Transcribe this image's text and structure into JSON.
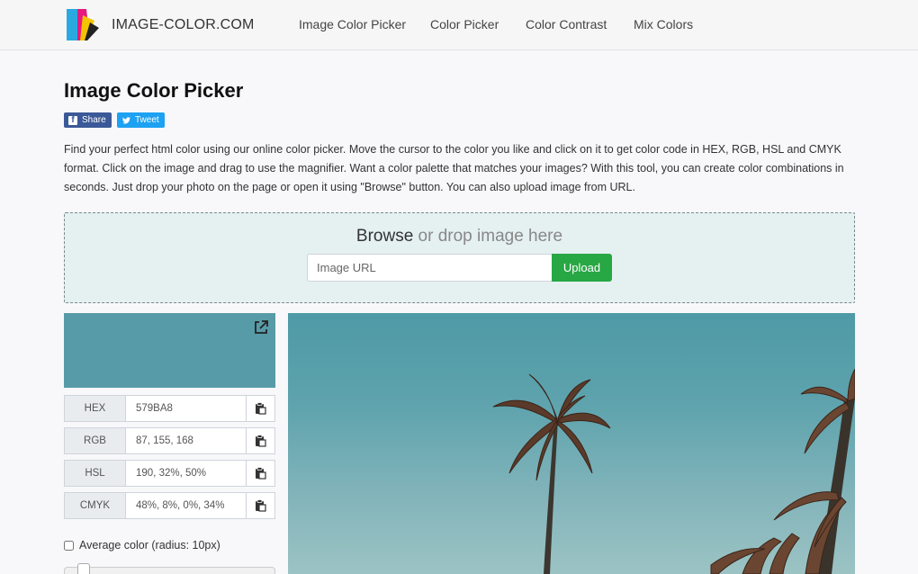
{
  "brand": {
    "name": "IMAGE-COLOR.COM"
  },
  "nav": {
    "links": [
      "Image Color Picker",
      "Color Picker",
      "Color Contrast",
      "Mix Colors"
    ]
  },
  "page": {
    "title": "Image Color Picker",
    "share_label": "Share",
    "tweet_label": "Tweet",
    "description": "Find your perfect html color using our online color picker. Move the cursor to the color you like and click on it to get color code in HEX, RGB, HSL and CMYK format. Click on the image and drag to use the magnifier. Want a color palette that matches your images? With this tool, you can create color combinations in seconds. Just drop your photo on the page or open it using \"Browse\" button. You can also upload image from URL."
  },
  "dropzone": {
    "browse_label": "Browse",
    "drop_text": " or drop image here",
    "url_placeholder": "Image URL",
    "upload_label": "Upload"
  },
  "picker": {
    "selected_color": "#579BA8",
    "rows": [
      {
        "label": "HEX",
        "value": "579BA8"
      },
      {
        "label": "RGB",
        "value": "87, 155, 168"
      },
      {
        "label": "HSL",
        "value": "190, 32%, 50%"
      },
      {
        "label": "CMYK",
        "value": "48%, 8%, 0%, 34%"
      }
    ],
    "average_label": "Average color (radius: 10px)",
    "average_checked": false
  },
  "icons": {
    "share": "facebook-icon",
    "tweet": "twitter-icon",
    "external": "external-link-icon",
    "copy": "clipboard-icon"
  },
  "colors": {
    "upload_button": "#28a745",
    "facebook": "#3b5998",
    "twitter": "#1da1f2"
  }
}
